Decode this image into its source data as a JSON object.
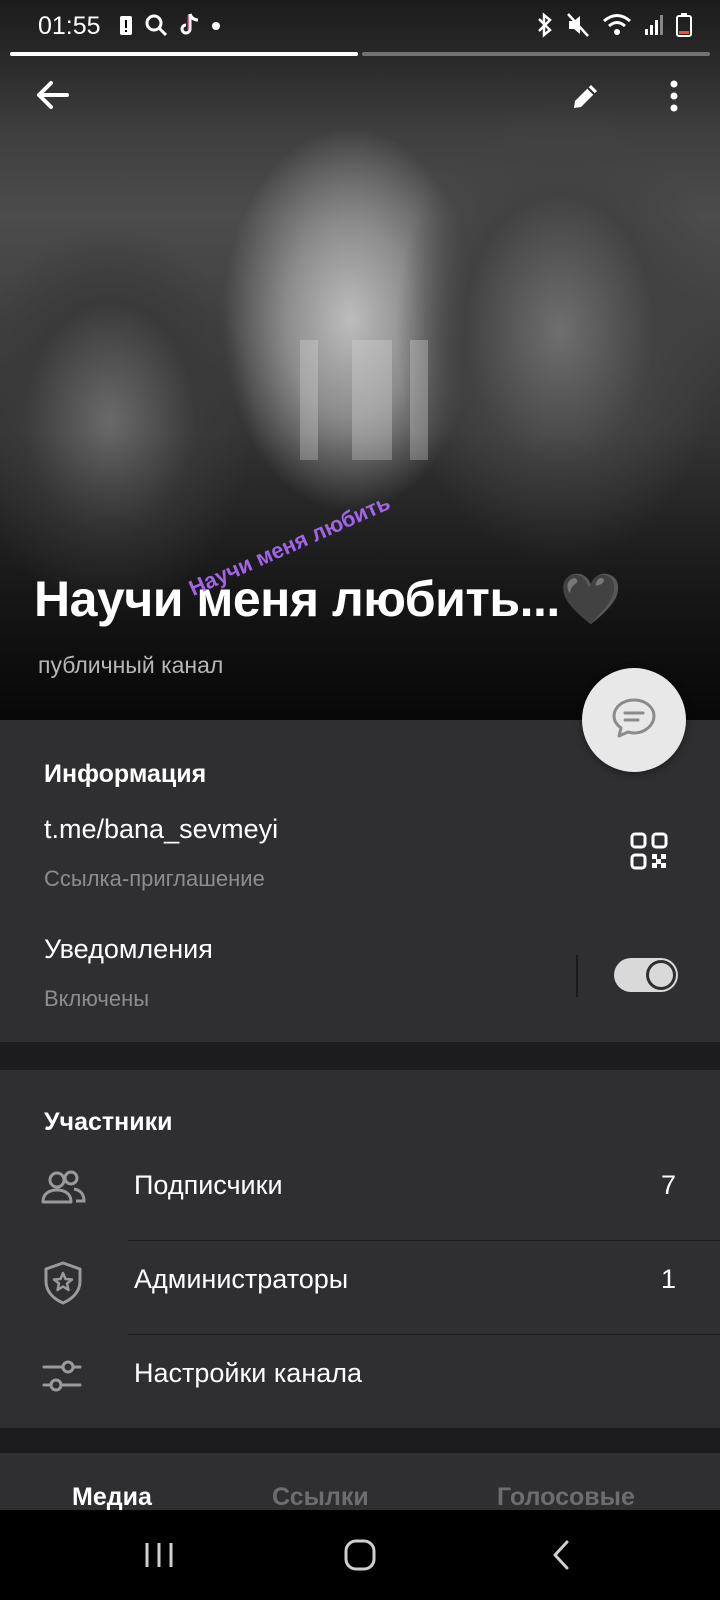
{
  "status_bar": {
    "time": "01:55",
    "left_icons": [
      "battery-alert-icon",
      "search-icon",
      "tiktok-icon",
      "dot-icon"
    ],
    "right_icons": [
      "bluetooth-icon",
      "mute-icon",
      "wifi-icon",
      "signal-icon",
      "battery-low-icon"
    ],
    "story_progress": [
      1.0,
      0.0
    ]
  },
  "header": {
    "back_icon": "arrow-left-icon",
    "edit_icon": "pencil-icon",
    "menu_icon": "more-vertical-icon",
    "channel_title": "Научи меня любить...🖤",
    "channel_type": "публичный канал",
    "watermark": "Научи меня любить"
  },
  "info": {
    "title": "Информация",
    "link": "t.me/bana_sevmeyi",
    "link_caption": "Ссылка-приглашение",
    "notifications_label": "Уведомления",
    "notifications_state": "Включены",
    "notifications_on": true
  },
  "members": {
    "title": "Участники",
    "items": [
      {
        "label": "Подписчики",
        "count": "7",
        "icon": "users-icon"
      },
      {
        "label": "Администраторы",
        "count": "1",
        "icon": "shield-star-icon"
      },
      {
        "label": "Настройки канала",
        "count": "",
        "icon": "sliders-icon"
      }
    ]
  },
  "tabs": [
    "Медиа",
    "Ссылки",
    "Голосовые"
  ],
  "colors": {
    "panel": "#2f2f31",
    "background": "#1c1c1e",
    "accent_watermark": "#b06cff"
  }
}
